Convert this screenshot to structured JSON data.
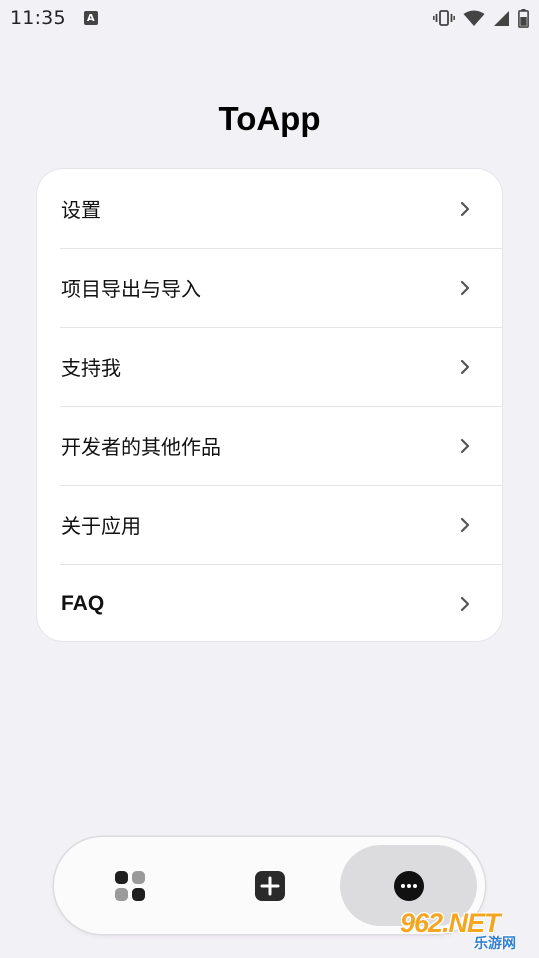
{
  "status_bar": {
    "time": "11:35",
    "notification_glyph": "A",
    "icons": [
      "vibrate-icon",
      "wifi-icon",
      "signal-icon",
      "battery-icon"
    ]
  },
  "title": "ToApp",
  "menu": {
    "items": [
      {
        "label": "设置"
      },
      {
        "label": "项目导出与导入"
      },
      {
        "label": "支持我"
      },
      {
        "label": "开发者的其他作品"
      },
      {
        "label": "关于应用"
      },
      {
        "label": "FAQ"
      }
    ]
  },
  "bottom_nav": {
    "items": [
      {
        "icon": "grid-icon",
        "selected": false
      },
      {
        "icon": "add-square-icon",
        "selected": false
      },
      {
        "icon": "more-circle-icon",
        "selected": true
      }
    ]
  },
  "watermark": {
    "main": "962.NET",
    "sub": "乐游网"
  },
  "colors": {
    "background": "#f2f1f6",
    "card": "#ffffff",
    "selected_pill": "#dcdcde",
    "icon_dark": "#1f1f1f",
    "watermark_orange": "#f4a623",
    "watermark_blue": "#2f7fd1"
  }
}
